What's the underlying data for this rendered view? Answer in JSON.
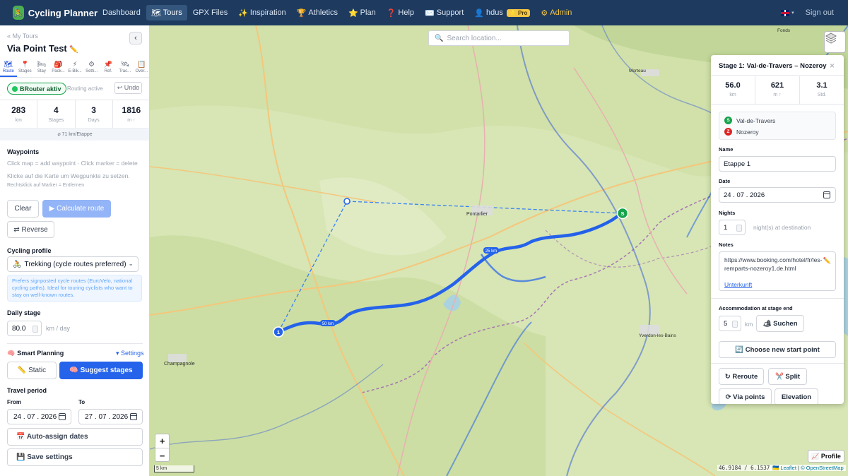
{
  "app": {
    "title": "Cycling Planner",
    "logo_glyph": "🚴"
  },
  "nav": {
    "items": [
      {
        "icon": "",
        "label": "Dashboard"
      },
      {
        "icon": "🗺",
        "label": "Tours"
      },
      {
        "icon": "",
        "label": "GPX Files"
      },
      {
        "icon": "✨",
        "label": "Inspiration"
      },
      {
        "icon": "🏆",
        "label": "Athletics"
      },
      {
        "icon": "⭐",
        "label": "Plan"
      },
      {
        "icon": "❓",
        "label": "Help"
      },
      {
        "icon": "✉️",
        "label": "Support"
      },
      {
        "icon": "👤",
        "label": "hdus"
      },
      {
        "icon": "⚙",
        "label": "Admin"
      }
    ],
    "pro_badge": "⭐ Pro",
    "signout": "Sign out",
    "language_caret": "▾"
  },
  "sidebar": {
    "back_link": "« My Tours",
    "tour_title": "Via Point Test",
    "edit_glyph": "✏️",
    "collapse_glyph": "‹",
    "tabs": [
      {
        "icon": "🗺",
        "label": "Route"
      },
      {
        "icon": "📍",
        "label": "Stages"
      },
      {
        "icon": "🛏",
        "label": "Stay"
      },
      {
        "icon": "🎒",
        "label": "Pack..."
      },
      {
        "icon": "⚡",
        "label": "E-Bik..."
      },
      {
        "icon": "⚙",
        "label": "Setti..."
      },
      {
        "icon": "📌",
        "label": "Ref."
      },
      {
        "icon": "🛰",
        "label": "Trac..."
      },
      {
        "icon": "📋",
        "label": "Over..."
      }
    ],
    "brouter_label": "BRouter aktiv",
    "routing_status": "Routing active",
    "undo_label": "↩ Undo",
    "stats": [
      {
        "value": "283",
        "unit": "km"
      },
      {
        "value": "4",
        "unit": "Stages"
      },
      {
        "value": "3",
        "unit": "Days"
      },
      {
        "value": "1816",
        "unit": "m ↑"
      }
    ],
    "avg_per_stage": "⌀ 71 km/Etappe",
    "waypoints": {
      "heading": "Waypoints",
      "hint_en": "Click map = add waypoint · Click marker = delete",
      "hint_de": "Klicke auf die Karte um Wegpunkte zu setzen.",
      "hint_small": "Rechtsklick auf Marker = Entfernen"
    },
    "clear_label": "Clear",
    "calculate_label": "▶ Calculate route",
    "reverse_label": "⇄ Reverse",
    "profile": {
      "heading": "Cycling profile",
      "selected": "Trekking (cycle routes preferred)",
      "selected_icon": "🚴",
      "info": "Prefers signposted cycle routes (EuroVelo, national cycling paths). Ideal for touring cyclists who want to stay on well-known routes."
    },
    "daily_stage": {
      "heading": "Daily stage",
      "value": "80.0",
      "unit": "km / day"
    },
    "smart_planning": {
      "heading": "Smart Planning",
      "heading_icon": "🧠",
      "settings_link": "▾ Settings",
      "static_label": "📏 Static",
      "suggest_label": "🧠 Suggest stages"
    },
    "travel_period": {
      "heading": "Travel period",
      "from_label": "From",
      "from_value": "24 . 07 . 2026",
      "to_label": "To",
      "to_value": "27 . 07 . 2026"
    },
    "auto_assign_label": "📅 Auto-assign dates",
    "save_settings_label": "💾 Save settings"
  },
  "map": {
    "search_placeholder": "Search location...",
    "zoom_in": "+",
    "zoom_out": "−",
    "scale_label": "5 km",
    "coordinates": "46.9184 / 6.1537",
    "attribution_leaflet": "🇺🇦 Leaflet",
    "attribution_sep": "|",
    "attribution_osm": "© OpenStreetMap",
    "profile_button": "📈 Profile",
    "marker_start": "S",
    "marker_via": "1",
    "distance_labels": [
      "25 km",
      "50 km"
    ],
    "place_labels": [
      "Pontarlier",
      "Champagnole",
      "Yverdon-les-Bains",
      "Morteau",
      "Fonds"
    ]
  },
  "stage_panel": {
    "title": "Stage 1: Val-de-Travers – Nozeroy",
    "close_glyph": "×",
    "stats": [
      {
        "value": "56.0",
        "unit": "km"
      },
      {
        "value": "621",
        "unit": "m ↑"
      },
      {
        "value": "3.1",
        "unit": "Std."
      }
    ],
    "start": {
      "badge": "S",
      "name": "Val-de-Travers"
    },
    "end": {
      "badge": "Z",
      "name": "Nozeroy"
    },
    "name_label": "Name",
    "name_value": "Etappe 1",
    "date_label": "Date",
    "date_value": "24 . 07 . 2026",
    "nights_label": "Nights",
    "nights_value": "1",
    "nights_suffix": "night(s) at destination",
    "notes_label": "Notes",
    "notes_value": "https://www.booking.com/hotel/fr/les-remparts-nozeroy1.de.html",
    "notes_link": "Unterkunft",
    "notes_edit_glyph": "✏️",
    "accommodation_label": "Accommodation at stage end",
    "accommodation_km": "5",
    "accommodation_unit": "km",
    "search_button": "🏕 Suchen",
    "new_start_button": "🔄 Choose new start point",
    "reroute_button": "↻ Reroute",
    "split_button": "✂️ Split",
    "via_button": "⟳ Via points",
    "elevation_button": "Elevation"
  },
  "colors": {
    "nav_bg": "#1e3a5f",
    "primary": "#2563eb",
    "route_blue": "#2563eb",
    "start_green": "#16a34a",
    "end_red": "#dc2626",
    "map_bg": "#d7e6b4",
    "lake": "#aad3df"
  }
}
